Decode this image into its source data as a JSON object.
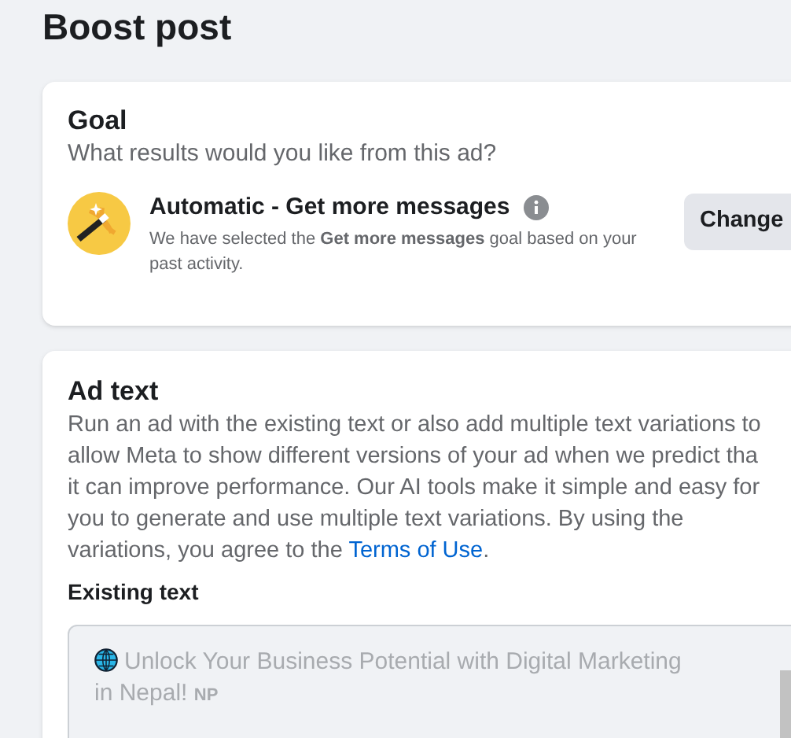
{
  "page_title": "Boost post",
  "goal": {
    "title": "Goal",
    "subtitle": "What results would you like from this ad?",
    "option_title": "Automatic - Get more messages",
    "option_description": "We have selected the **Get more messages** goal based on your past activity.",
    "button": "Change"
  },
  "ad_text": {
    "title": "Ad text",
    "description_lines": [
      "Run an ad with the existing text or also add multiple text variations to",
      "allow Meta to show different versions of your ad when we predict tha",
      "it can improve performance. Our AI tools make it simple and easy for",
      "you to generate and use multiple text variations. By using the"
    ],
    "description_last": "variations, you agree to the ",
    "link": "Terms of Use",
    "description_end": ".",
    "existing_label": "Existing text",
    "existing_value": "Unlock Your Business Potential with Digital Marketing in Nepal!",
    "existing_badge": "NP"
  }
}
